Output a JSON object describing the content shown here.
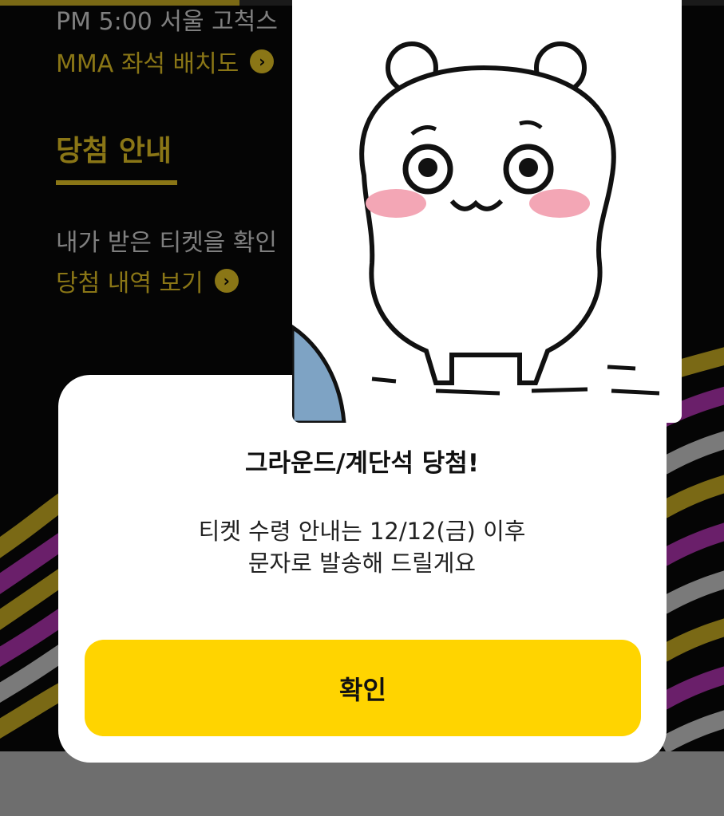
{
  "background": {
    "event_time_text": "PM 5:00 서울 고척스",
    "seat_map_link": "MMA 좌석 배치도",
    "section_title": "당첨 안내",
    "ticket_check_text": "내가 받은 티켓을 확인",
    "history_link": "당첨 내역 보기"
  },
  "dialog": {
    "title": "그라운드/계단석 당첨!",
    "message_line1": "티켓 수령 안내는 12/12(금) 이후",
    "message_line2": "문자로 발송해 드릴게요",
    "confirm_label": "확인"
  },
  "colors": {
    "accent_gold": "#8a7616",
    "button_yellow": "#ffd400",
    "stripe_purple": "#6a1f6a",
    "stripe_gray": "#7a7a7a"
  },
  "icons": {
    "arrow": "chevron-right-circle-icon",
    "sticker": "white-bear-sticker"
  }
}
